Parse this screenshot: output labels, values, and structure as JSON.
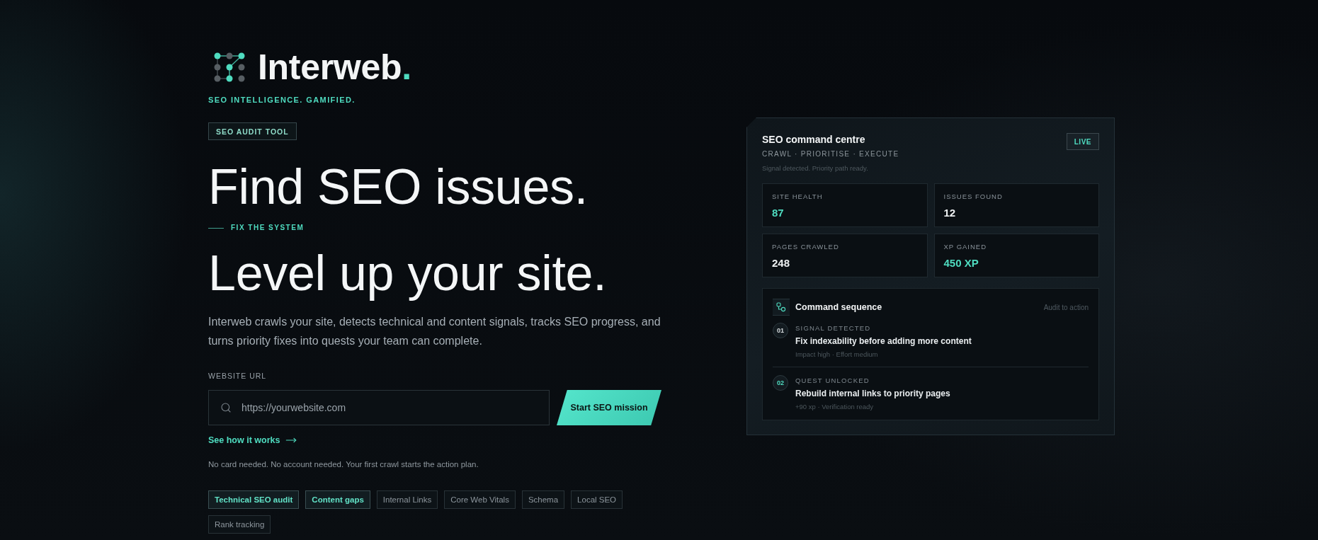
{
  "brand": {
    "name": "Interweb",
    "suffix": ".",
    "tagline": "SEO INTELLIGENCE. GAMIFIED."
  },
  "hero": {
    "badge": "SEO AUDIT TOOL",
    "headline": "Find SEO issues.",
    "eyebrow": "FIX THE SYSTEM",
    "subheadline": "Level up your site.",
    "description": "Interweb crawls your site, detects technical and content signals, tracks SEO progress, and turns priority fixes into quests your team can complete.",
    "url_field": {
      "label": "WEBSITE URL",
      "placeholder": "https://yourwebsite.com"
    },
    "cta": "Start SEO mission",
    "link": "See how it works",
    "note": "No card needed. No account needed. Your first crawl starts the action plan."
  },
  "tags": [
    {
      "label": "Technical SEO audit",
      "selected": true
    },
    {
      "label": "Content gaps",
      "selected": true
    },
    {
      "label": "Internal Links",
      "selected": false
    },
    {
      "label": "Core Web Vitals",
      "selected": false
    },
    {
      "label": "Schema",
      "selected": false
    },
    {
      "label": "Local SEO",
      "selected": false
    },
    {
      "label": "Rank tracking",
      "selected": false
    }
  ],
  "command_centre": {
    "title": "SEO command centre",
    "status": "LIVE",
    "subtitle": "CRAWL · PRIORITISE · EXECUTE",
    "message": "Signal detected. Priority path ready.",
    "stats": [
      {
        "label": "SITE HEALTH",
        "value": "87",
        "highlighted": true
      },
      {
        "label": "ISSUES FOUND",
        "value": "12",
        "highlighted": false
      },
      {
        "label": "PAGES CRAWLED",
        "value": "248",
        "highlighted": false
      },
      {
        "label": "XP GAINED",
        "value": "450 XP",
        "highlighted": true
      }
    ],
    "sequence": {
      "title": "Command sequence",
      "caption": "Audit to action",
      "steps": [
        {
          "number": "01",
          "label": "SIGNAL DETECTED",
          "title": "Fix indexability before adding more content",
          "meta": "Impact high · Effort medium",
          "active": false
        },
        {
          "number": "02",
          "label": "QUEST UNLOCKED",
          "title": "Rebuild internal links to priority pages",
          "meta": "+90 xp · Verification ready",
          "active": true
        }
      ]
    }
  }
}
